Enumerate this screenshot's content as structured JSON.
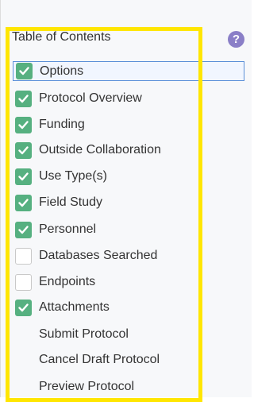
{
  "toc": {
    "title": "Table of Contents",
    "help_icon": "?",
    "items": [
      {
        "label": "Options",
        "checked": true,
        "active": true
      },
      {
        "label": "Protocol Overview",
        "checked": true
      },
      {
        "label": "Funding",
        "checked": true
      },
      {
        "label": "Outside Collaboration",
        "checked": true
      },
      {
        "label": "Use Type(s)",
        "checked": true
      },
      {
        "label": "Field Study",
        "checked": true
      },
      {
        "label": "Personnel",
        "checked": true
      },
      {
        "label": "Databases Searched",
        "checked": false
      },
      {
        "label": "Endpoints",
        "checked": false
      },
      {
        "label": "Attachments",
        "checked": true
      }
    ],
    "actions": [
      {
        "label": "Submit Protocol"
      },
      {
        "label": "Cancel Draft Protocol"
      },
      {
        "label": "Preview Protocol"
      }
    ]
  },
  "colors": {
    "check_green": "#56b080",
    "highlight_yellow": "#ffe600",
    "help_purple": "#8a7fc7",
    "active_border": "#5a8fd8"
  }
}
